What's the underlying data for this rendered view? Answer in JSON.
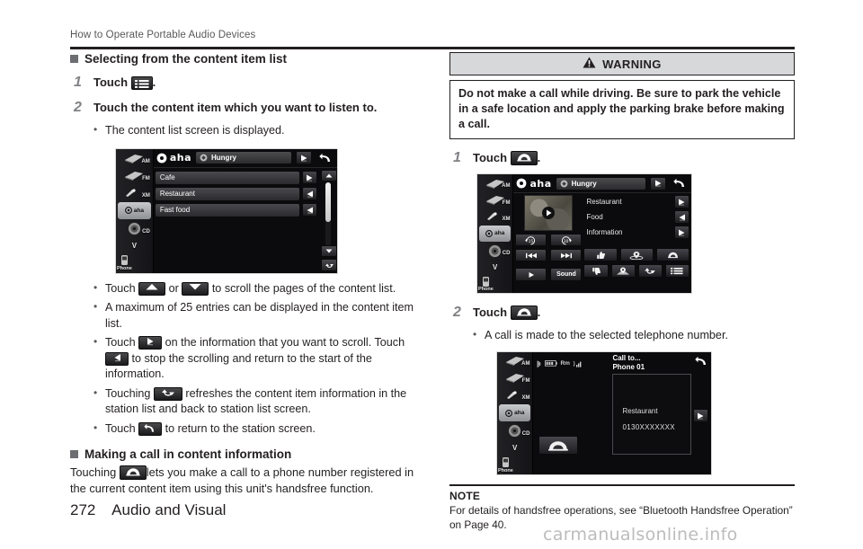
{
  "header": {
    "running_title": "How to Operate Portable Audio Devices"
  },
  "footer": {
    "page_number": "272",
    "section": "Audio and Visual",
    "watermark": "carmanualsonline.info"
  },
  "left_column": {
    "section_heading": "Selecting from the content item list",
    "step1": {
      "number": "1",
      "text_before": "Touch",
      "text_after": "."
    },
    "step2": {
      "number": "2",
      "text": "Touch the content item which you want to listen to."
    },
    "step2_note": "The content list screen is displayed.",
    "bullets": [
      {
        "parts": [
          "Touch",
          "or",
          "to scroll the pages of the content list."
        ]
      },
      {
        "text": "A maximum of 25 entries can be displayed in the content item list."
      },
      {
        "parts": [
          "Touch",
          "on the information that you want to scroll. Touch",
          "to stop the scrolling and return to the start of the information."
        ]
      },
      {
        "parts": [
          "Touching",
          "refreshes the content item information in the station list and back to station list screen."
        ]
      },
      {
        "parts": [
          "Touch",
          "to return to the station screen."
        ]
      }
    ],
    "section_heading2": "Making a call in content information",
    "para_before": "Touching",
    "para_after": "lets you make a call to a phone number registered in the current content item using this unit's handsfree function."
  },
  "right_column": {
    "warning_label": "WARNING",
    "warning_text": "Do not make a call while driving. Be sure to park the vehicle in a safe location and apply the parking brake before making a call.",
    "step1": {
      "number": "1",
      "text_before": "Touch",
      "text_after": "."
    },
    "step2": {
      "number": "2",
      "text_before": "Touch",
      "text_after": "."
    },
    "step2_note": "A call is made to the selected telephone number.",
    "note_title": "NOTE",
    "note_text": "For details of handsfree operations, see “Bluetooth Handsfree Operation” on Page 40."
  },
  "screenshot_list": {
    "rail": [
      {
        "label": "AM",
        "icon": "radio-icon",
        "selected": false
      },
      {
        "label": "FM",
        "icon": "radio-icon",
        "selected": false
      },
      {
        "label": "XM",
        "icon": "satellite-icon",
        "selected": false
      },
      {
        "label": "aha",
        "icon": "aha-icon",
        "selected": true
      },
      {
        "label": "CD",
        "icon": "disc-icon",
        "selected": false
      },
      {
        "label": "V",
        "icon": "chevron-down-icon",
        "selected": false
      },
      {
        "label": "Phone",
        "icon": "phone-icon",
        "selected": false
      }
    ],
    "brand": "aha",
    "now_playing": "Hungry",
    "rows": [
      {
        "label": "Cafe",
        "scroll_icon": "scroll-forward-icon"
      },
      {
        "label": "Restaurant",
        "scroll_icon": "scroll-back-icon"
      },
      {
        "label": "Fast food",
        "scroll_icon": "scroll-back-icon"
      }
    ]
  },
  "screenshot_player": {
    "brand": "aha",
    "now_playing": "Hungry",
    "transport": [
      {
        "name": "rewind-15-icon",
        "label": "15"
      },
      {
        "name": "forward-30-icon",
        "label": "30"
      },
      {
        "name": "previous-track-icon",
        "label": ""
      },
      {
        "name": "next-track-icon",
        "label": ""
      },
      {
        "name": "play-icon",
        "label": ""
      },
      {
        "name": "sound-button",
        "label": "Sound"
      }
    ],
    "info_rows": [
      {
        "label": "Restaurant",
        "scroll_icon": "scroll-forward-icon"
      },
      {
        "label": "Food",
        "scroll_icon": "scroll-back-icon"
      },
      {
        "label": "Information",
        "scroll_icon": "scroll-forward-icon"
      }
    ],
    "function_buttons_row1": [
      "thumb-up-icon",
      "map-pin-route-icon",
      "phone-icon"
    ],
    "function_buttons_row2": [
      "thumb-down-icon",
      "destination-icon",
      "refresh-icon",
      "list-icon"
    ]
  },
  "screenshot_call": {
    "status_icons": [
      "bluetooth-icon",
      "battery-icon",
      "roaming-icon",
      "signal-icon"
    ],
    "roaming_text": "Rm",
    "title_line1": "Call to...",
    "title_line2": "Phone 01",
    "contact_name": "Restaurant",
    "contact_number": "0130XXXXXXX",
    "call_button": "call-icon",
    "return_button": "return-icon"
  }
}
